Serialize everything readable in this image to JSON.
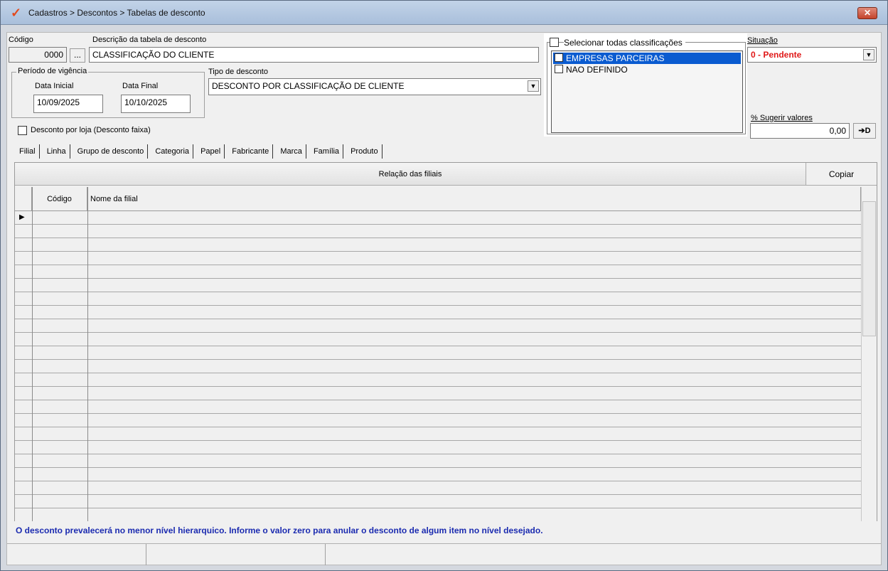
{
  "window": {
    "title": "Cadastros > Descontos > Tabelas de desconto",
    "icon": "check-logo-icon",
    "close_label": "✕"
  },
  "form": {
    "codigo_label": "Código",
    "codigo_value": "0000",
    "lookup_label": "...",
    "descricao_label": "Descrição da tabela de desconto",
    "descricao_value": "CLASSIFICAÇÃO DO CLIENTE",
    "vigencia_title": "Período de vigência",
    "data_inicial_label": "Data Inicial",
    "data_inicial_value": "10/09/2025",
    "data_final_label": "Data Final",
    "data_final_value": "10/10/2025",
    "tipo_label": "Tipo de desconto",
    "tipo_value": "DESCONTO POR CLASSIFICAÇÃO DE CLIENTE",
    "desconto_loja_label": "Desconto por loja (Desconto faixa)",
    "situacao_label": "Situação",
    "situacao_value": "0 - Pendente",
    "situacao_color": "#e01818",
    "sugerir_label": "% Sugerir valores",
    "sugerir_value": "0,00",
    "sugerir_btn": "➔D"
  },
  "classificacoes": {
    "select_all_label": "Selecionar todas classificações",
    "items": [
      {
        "label": "EMPRESAS PARCEIRAS",
        "checked": true,
        "selected": true
      },
      {
        "label": "NAO DEFINIDO",
        "checked": false,
        "selected": false
      }
    ]
  },
  "tabs": [
    "Filial",
    "Linha",
    "Grupo de desconto",
    "Categoria",
    "Papel",
    "Fabricante",
    "Marca",
    "Família",
    "Produto"
  ],
  "grid": {
    "header": "Relação das filiais",
    "copy_label": "Copiar",
    "columns": [
      "Código",
      "Nome da filial"
    ],
    "row_marker": "▶"
  },
  "hint": "O desconto prevalecerá no menor nível hierarquico. Informe o valor zero para anular o desconto de algum item no nível desejado."
}
